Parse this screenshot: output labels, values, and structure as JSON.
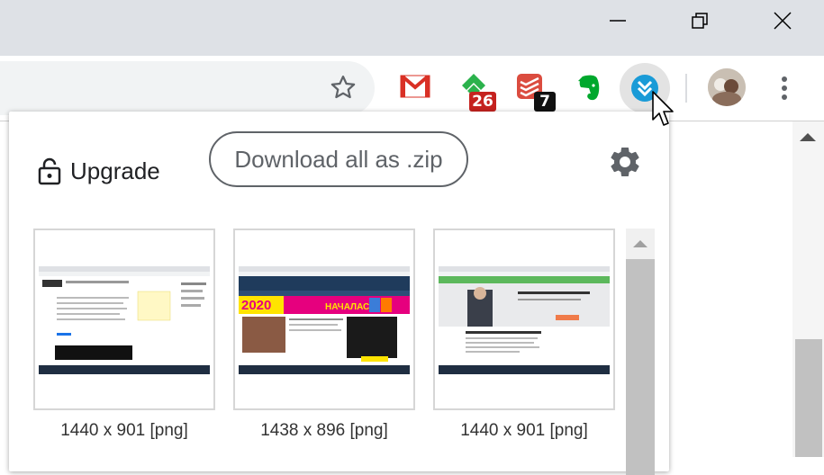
{
  "window": {
    "minimize_icon": "minimize-icon",
    "restore_icon": "restore-icon",
    "close_icon": "close-icon"
  },
  "toolbar": {
    "bookmark_icon": "star-icon",
    "extensions": [
      {
        "name": "gmail",
        "icon": "gmail-icon"
      },
      {
        "name": "feedly",
        "icon": "feedly-icon",
        "badge": "26",
        "badge_color": "#c5221f"
      },
      {
        "name": "todoist",
        "icon": "todoist-icon",
        "badge": "7",
        "badge_color": "#111111"
      },
      {
        "name": "evernote",
        "icon": "evernote-icon"
      },
      {
        "name": "download-all",
        "icon": "double-chevron-down-icon",
        "active": true
      }
    ],
    "menu_icon": "more-vert-icon"
  },
  "popup": {
    "upgrade_label": "Upgrade",
    "download_zip_label": "Download all as .zip",
    "settings_icon": "gear-icon",
    "images": [
      {
        "caption": "1440 x 901 [png]"
      },
      {
        "caption": "1438 x 896 [png]"
      },
      {
        "caption": "1440 x 901 [png]"
      }
    ],
    "thumb_texts": [
      "2020",
      "НАЧАЛАСЬ"
    ]
  },
  "colors": {
    "titlebar": "#dee1e6",
    "gmail_red": "#d93025",
    "feedly_green": "#2bb24c",
    "todoist_red": "#db4c3f",
    "evernote_green": "#00a82d",
    "extension_blue": "#1a73e8"
  }
}
